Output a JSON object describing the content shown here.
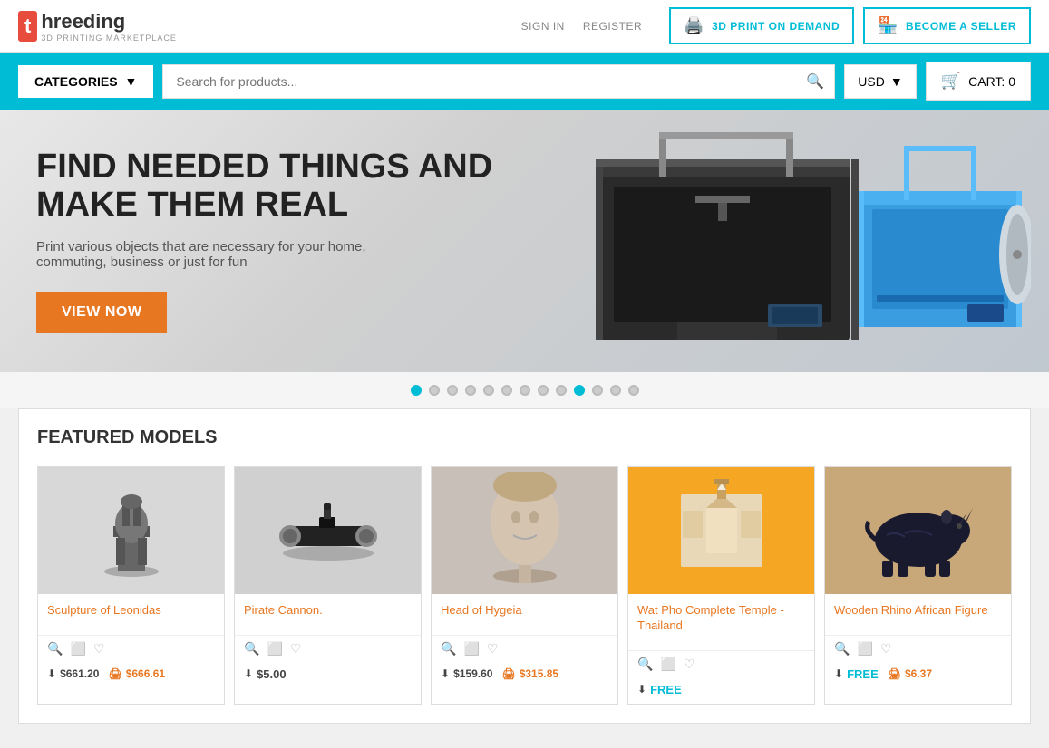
{
  "header": {
    "logo_letter": "t",
    "logo_name": "hreeding",
    "logo_sub": "3D PRINTING MARKETPLACE",
    "sign_in": "SIGN IN",
    "register": "REGISTER",
    "print_on_demand": "3D PRINT ON DEMAND",
    "become_seller": "BECOME A SELLER"
  },
  "navbar": {
    "categories_label": "CATEGORIES",
    "search_placeholder": "Search for products...",
    "currency": "USD",
    "cart_label": "CART: 0"
  },
  "hero": {
    "title_line1": "FIND NEEDED THINGS AND",
    "title_line2": "MAKE THEM REAL",
    "subtitle": "Print various objects that are necessary for your home, commuting, business or just for fun",
    "cta_button": "VIEW NOW"
  },
  "dots": {
    "count": 13,
    "active": 10
  },
  "featured": {
    "section_title": "FEATURED MODELS",
    "products": [
      {
        "name": "Sculpture of Leonidas",
        "price_download": "$661.20",
        "price_print": "$666.61",
        "bg_color": "#e8e8e8",
        "emoji": "🗿"
      },
      {
        "name": "Pirate Cannon.",
        "price_download": "",
        "price_print": "$5.00",
        "bg_color": "#e8e8e8",
        "emoji": "💣"
      },
      {
        "name": "Head of Hygeia",
        "price_download": "$159.60",
        "price_print": "$315.85",
        "bg_color": "#e0dcd8",
        "emoji": "🗽"
      },
      {
        "name": "Wat Pho Complete Temple - Thailand",
        "price_download": "FREE",
        "price_print": "",
        "bg_color": "#f5a623",
        "emoji": "🏛️"
      },
      {
        "name": "Wooden Rhino African Figure",
        "price_download": "FREE",
        "price_print": "$6.37",
        "bg_color": "#c8a878",
        "emoji": "🦏"
      }
    ]
  }
}
